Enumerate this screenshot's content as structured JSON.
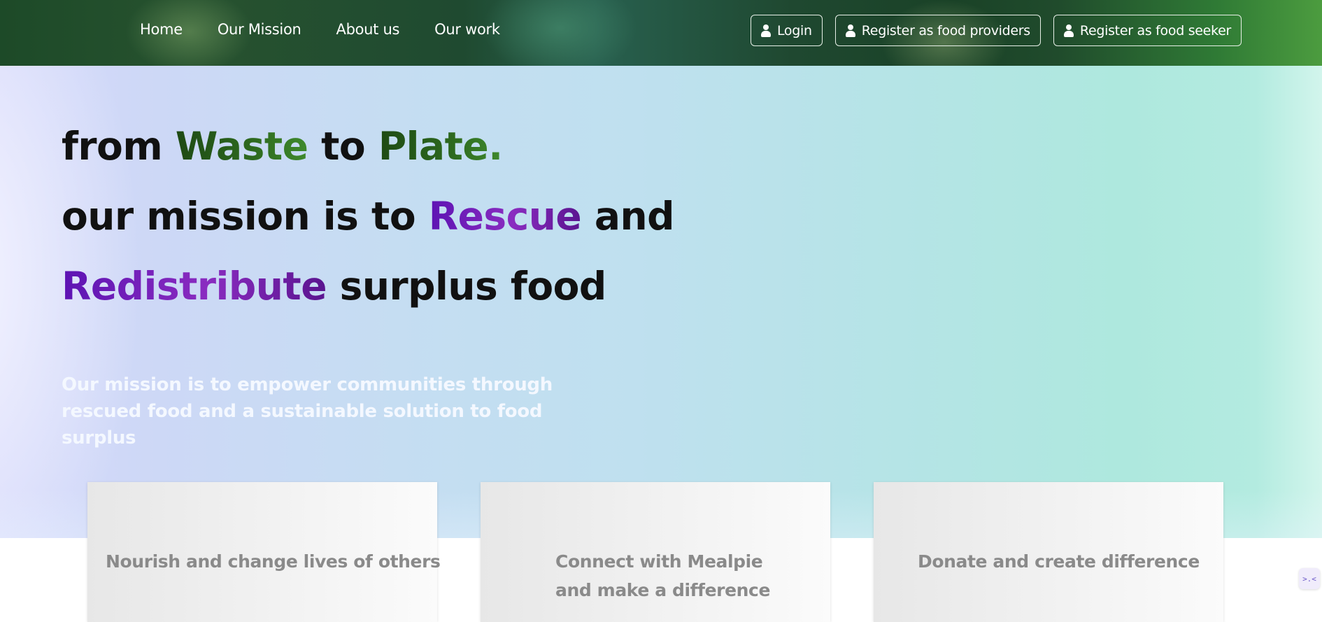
{
  "nav": {
    "links": [
      "Home",
      "Our Mission",
      "About us",
      "Our work"
    ],
    "buttons": [
      "Login",
      "Register as food providers",
      "Register as food seeker"
    ],
    "button_icon": "user-icon"
  },
  "hero": {
    "line1": {
      "a": "from ",
      "b": "Waste",
      "c": " to ",
      "d": "Plate."
    },
    "line2": {
      "a": "our mission is to ",
      "b": "Rescue",
      "c": " and"
    },
    "line3": {
      "a": "Redistribute",
      "b": " surplus food"
    },
    "subtitle": "Our mission is to empower communities through rescued food and a sustainable solution to food surplus"
  },
  "cards": [
    "Nourish and change lives of others",
    "Connect with Mealpie and make a difference",
    "Donate and create difference"
  ],
  "widget": {
    "glyph": ">.<"
  },
  "colors": {
    "nav_green": "#1d4a28",
    "accent_green": "#2e6a1f",
    "accent_purple": "#8a2cc0"
  }
}
